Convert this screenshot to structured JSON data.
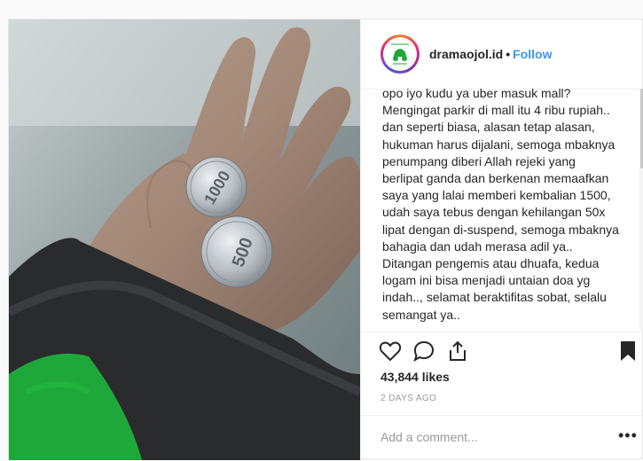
{
  "post": {
    "username": "dramaojol.id",
    "separator": "•",
    "follow_label": "Follow",
    "avatar_icon": "green-scooter-logo",
    "caption": "opo iyo kudu ya uber masuk mall?\nMengingat parkir di mall itu 4 ribu rupiah..\ndan seperti biasa, alasan tetap alasan,\nhukuman harus dijalani, semoga mbaknya\npenumpang diberi Allah rejeki yang\nberlipat ganda dan berkenan memaafkan\nsaya yang lalai memberi kembalian 1500,\nudah saya tebus dengan kehilangan 50x\nlipat dengan di-suspend, semoga mbaknya\nbahagia dan udah merasa adil ya..\nDitangan pengemis atau dhuafa, kedua\nlogam ini bisa menjadi untaian doa yg\nindah.., selamat beraktifitas sobat, selalu\nsemangat ya..\n-",
    "likes": "43,844 likes",
    "time_ago": "2 DAYS AGO",
    "comment_placeholder": "Add a comment...",
    "more_label": "•••"
  },
  "photo": {
    "coin_1_value": "1000",
    "coin_2_value": "500"
  },
  "icons": {
    "like": "heart-icon",
    "comment": "comment-bubble-icon",
    "share": "share-icon",
    "save": "bookmark-icon"
  },
  "colors": {
    "follow": "#3897f0",
    "sleeve_green": "#1fa83a",
    "bookmark": "#262626"
  }
}
